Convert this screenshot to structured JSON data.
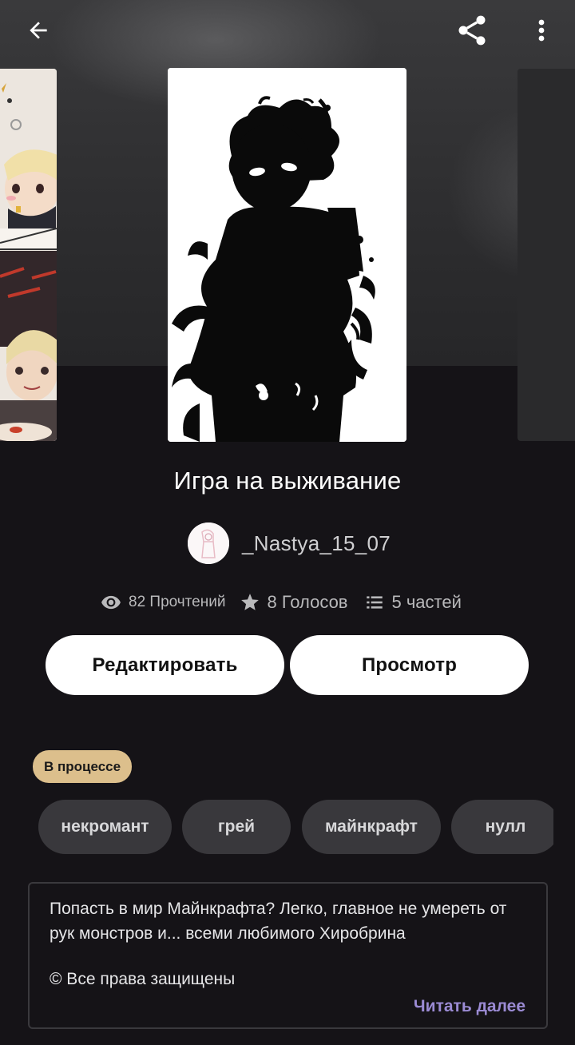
{
  "header": {
    "back_icon": "arrow-left-icon",
    "share_icon": "share-icon",
    "more_icon": "more-vertical-icon"
  },
  "story": {
    "title": "Игра на выживание",
    "author": "_Nastya_15_07"
  },
  "stats": {
    "reads": "82 Прочтений",
    "votes": "8 Голосов",
    "parts": "5 частей"
  },
  "actions": {
    "edit_label": "Редактировать",
    "view_label": "Просмотр"
  },
  "status": "В процессе",
  "tags": [
    "некромант",
    "грей",
    "майнкрафт",
    "нулл"
  ],
  "description": {
    "text": "Попасть в мир Майнкрафта? Легко, главное не умереть от рук монстров и... всеми любимого Хиробрина",
    "copyright": "© Все права защищены",
    "read_more": "Читать далее"
  },
  "colors": {
    "background": "#151317",
    "status_badge": "#dcbf8c",
    "read_more": "#9b8bd4",
    "tag_bg": "#39383c"
  }
}
